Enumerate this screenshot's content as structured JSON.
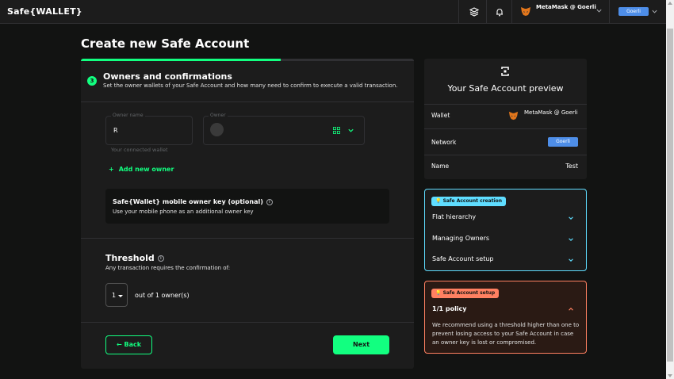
{
  "header": {
    "logo": "Safe{WALLET}",
    "wallet_label": "MetaMask @ Goerli",
    "network": "Goerli"
  },
  "page_title": "Create new Safe Account",
  "progress_percent": 60,
  "step": {
    "number": "3",
    "title": "Owners and confirmations",
    "subtitle": "Set the owner wallets of your Safe Account and how many need to confirm to execute a valid transaction."
  },
  "owner_form": {
    "name_label": "Owner name",
    "name_value": "R",
    "owner_label": "Owner",
    "helper": "Your connected wallet",
    "add_owner": "Add new owner"
  },
  "mobile_key": {
    "title": "Safe{Wallet} mobile owner key (optional)",
    "subtitle": "Use your mobile phone as an additional owner key"
  },
  "threshold": {
    "title": "Threshold",
    "subtitle": "Any transaction requires the confirmation of:",
    "value": "1",
    "suffix": "out of 1 owner(s)"
  },
  "buttons": {
    "back": "Back",
    "next": "Next"
  },
  "preview": {
    "title": "Your Safe Account preview",
    "wallet_key": "Wallet",
    "wallet_value": "MetaMask @ Goerli",
    "network_key": "Network",
    "network_value": "Goerli",
    "name_key": "Name",
    "name_value": "Test"
  },
  "info_panel": {
    "chip": "Safe Account creation",
    "items": [
      "Flat hierarchy",
      "Managing Owners",
      "Safe Account setup"
    ]
  },
  "warn_panel": {
    "chip": "Safe Account setup",
    "title": "1/1 policy",
    "body": "We recommend using a threshold higher than one to prevent losing access to your Safe Account in case an owner key is lost or compromised."
  },
  "colors": {
    "accent": "#12ff80",
    "info": "#5fddff",
    "warning": "#ff8061",
    "network": "#4e8ee8"
  }
}
